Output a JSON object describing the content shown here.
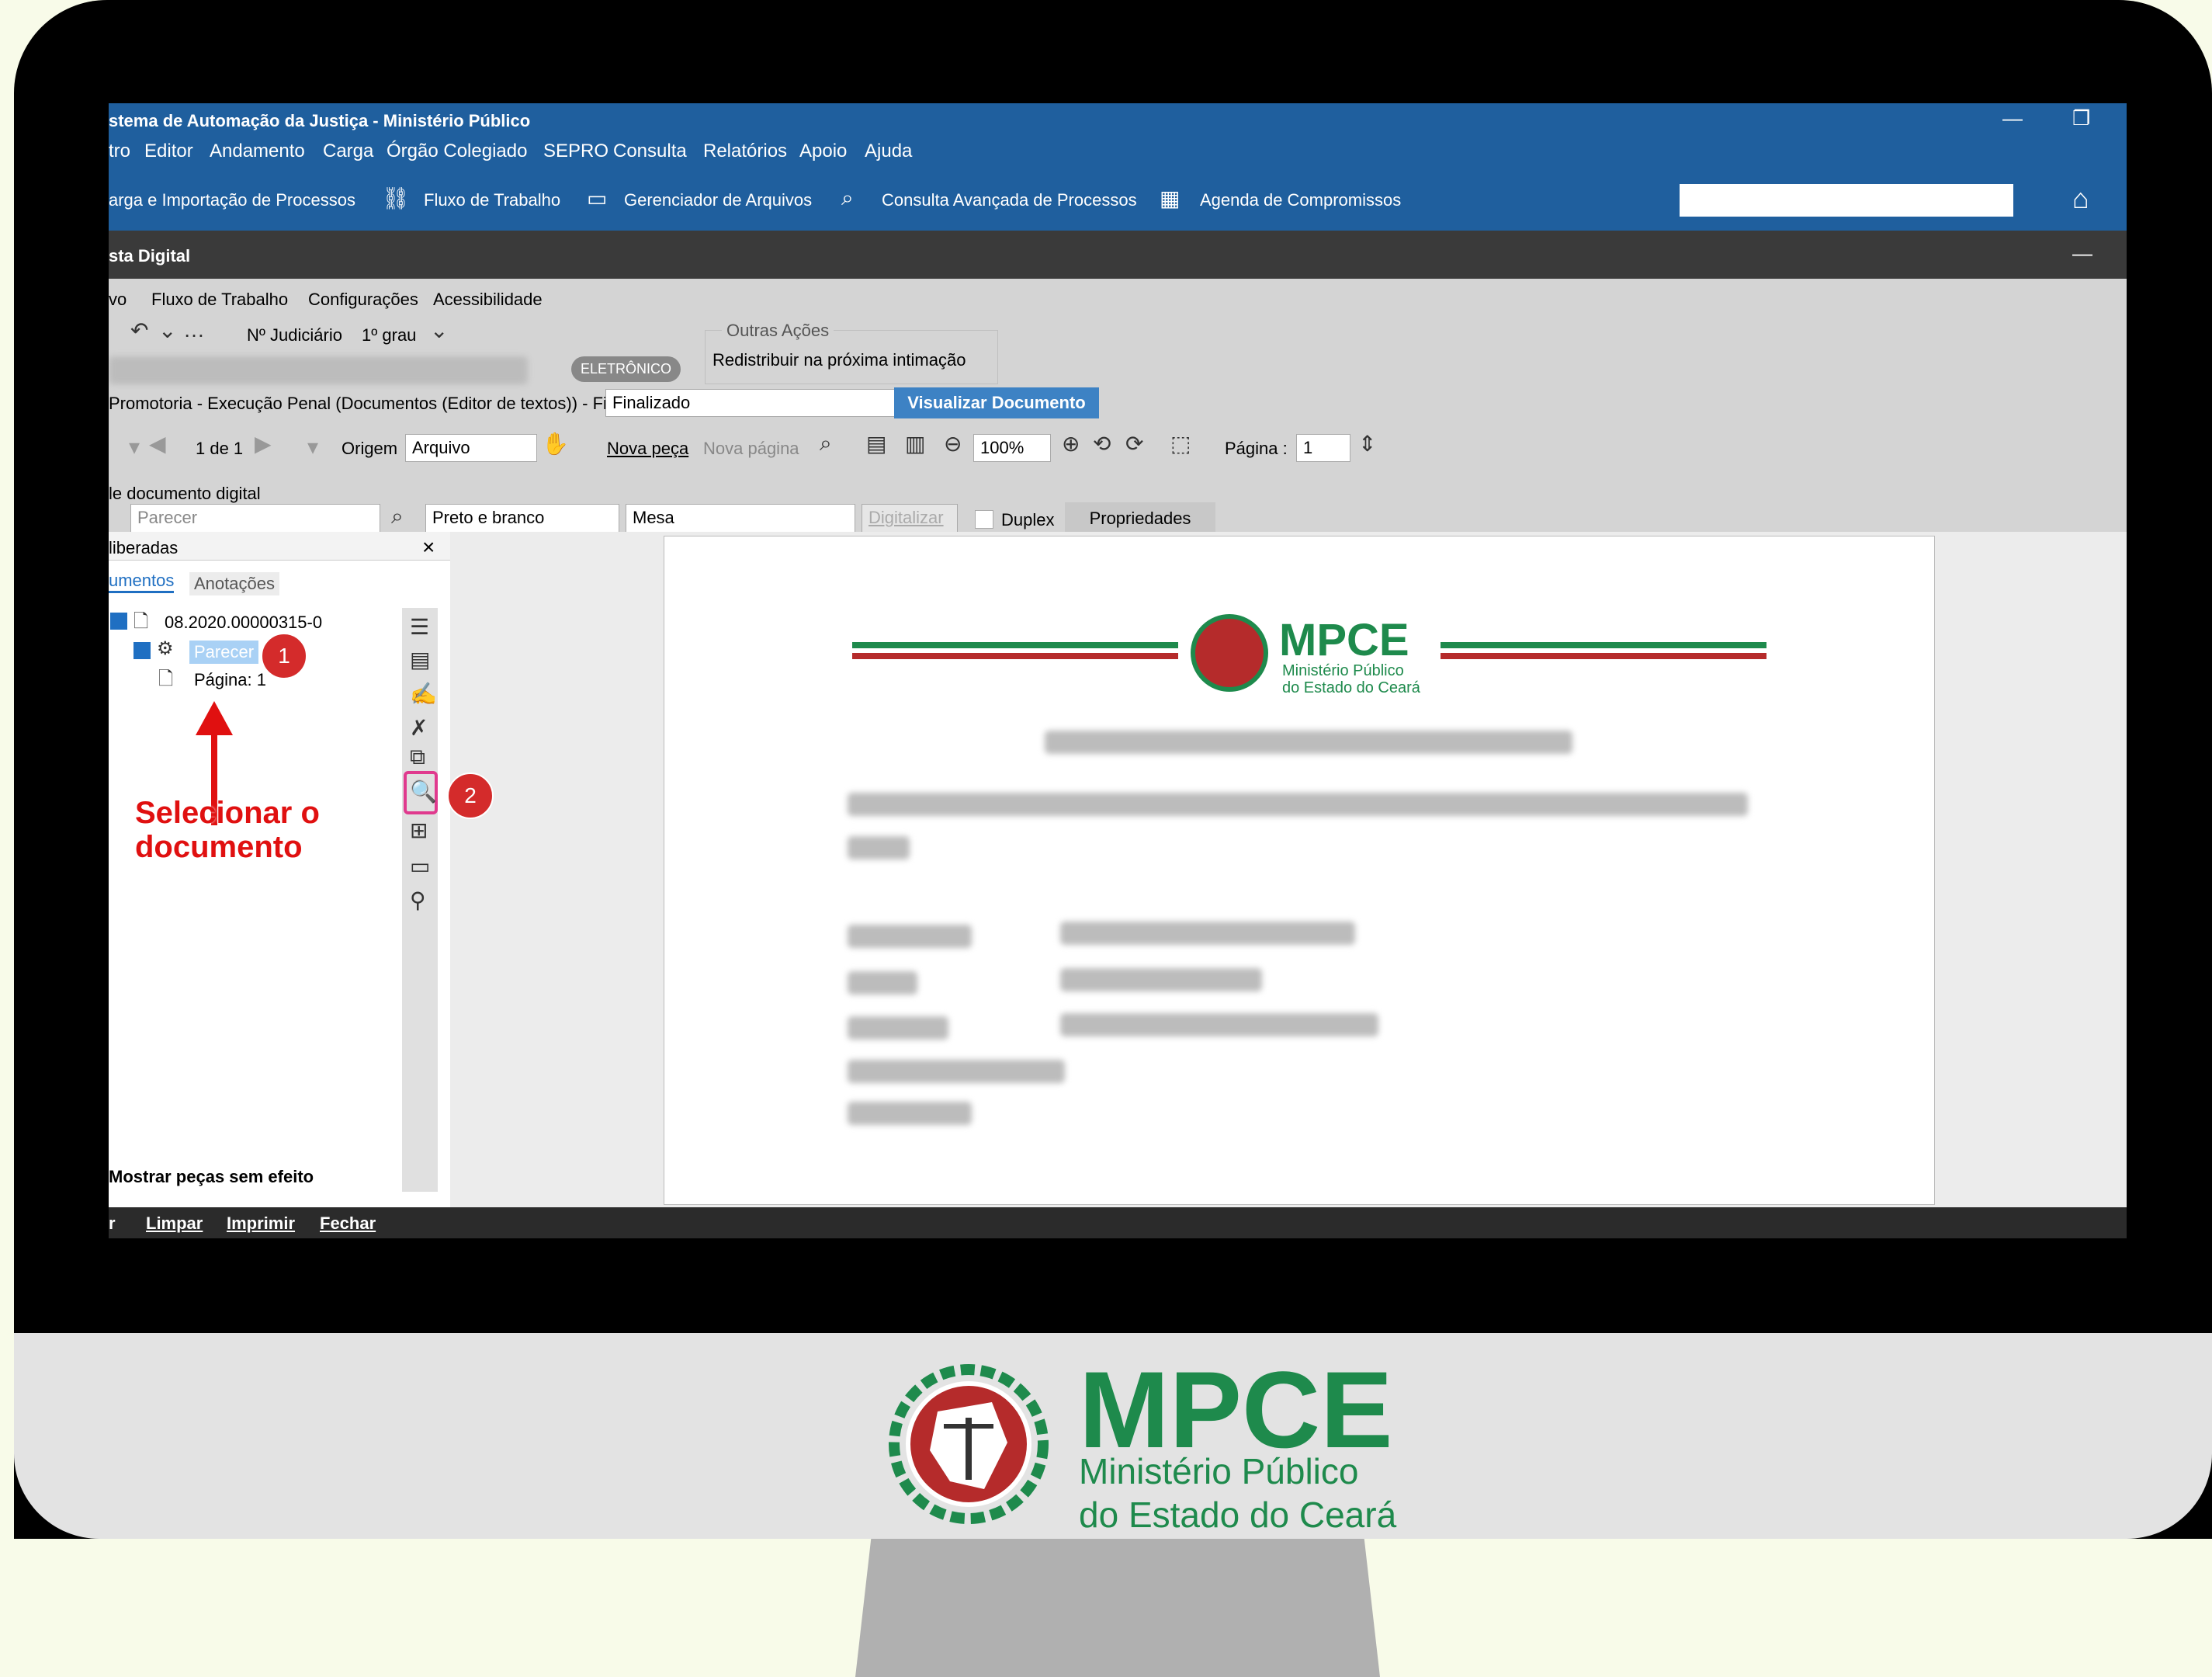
{
  "window": {
    "title": "stema de Automação da Justiça - Ministério Público",
    "minimize_glyph": "—",
    "restore_glyph": "❐"
  },
  "menu": [
    "tro",
    "Editor",
    "Andamento",
    "Carga",
    "Órgão Colegiado",
    "SEPRO",
    "Consulta",
    "Relatórios",
    "Apoio",
    "Ajuda"
  ],
  "toolbar": {
    "items": [
      {
        "label": "arga e Importação de Processos",
        "icon": ""
      },
      {
        "label": "Fluxo de Trabalho",
        "icon": "flow-icon"
      },
      {
        "label": "Gerenciador de Arquivos",
        "icon": "file-manager-icon"
      },
      {
        "label": "Consulta Avançada de Processos",
        "icon": "search-icon"
      },
      {
        "label": "Agenda de Compromissos",
        "icon": "calendar-icon"
      }
    ],
    "search_value": "",
    "home_icon": "home-icon"
  },
  "subwindow": {
    "title": "sta Digital",
    "minimize_glyph": "—",
    "menu": [
      "vo",
      "Fluxo de Trabalho",
      "Configurações",
      "Acessibilidade"
    ]
  },
  "header": {
    "judicial_label": "Nº Judiciário",
    "instance": "1º grau",
    "eletronico_badge": "ELETRÔNICO",
    "outras_acoes_title": "Outras Ações",
    "redistribuir": "Redistribuir na próxima intimação",
    "queue_label": "Promotoria - Execução Penal (Documentos (Editor de textos)) - Fila",
    "queue_value": "Finalizado",
    "visualizar_button": "Visualizar Documento"
  },
  "viewer_toolbar": {
    "page_of": "1 de 1",
    "origem_label": "Origem",
    "origem_value": "Arquivo",
    "nova_peca": "Nova peça",
    "nova_pagina": "Nova página",
    "zoom": "100%",
    "pagina_label": "Página :",
    "pagina_value": "1"
  },
  "scan": {
    "section_label": "le documento digital",
    "type_placeholder": "Parecer",
    "color_value": "Preto e branco",
    "source_value": "Mesa",
    "digitalizar": "Digitalizar",
    "duplex": "Duplex",
    "propriedades": "Propriedades"
  },
  "left_panel": {
    "title": "liberadas",
    "close": "×",
    "tabs": [
      "umentos",
      "Anotações"
    ],
    "tree": {
      "root": "08.2020.00000315-0",
      "child": "Parecer",
      "page": "Página: 1"
    },
    "show_effectless": "Mostrar peças sem efeito"
  },
  "annotations": {
    "badge1": "1",
    "badge2": "2",
    "arrow_text_line1": "Selecionar o",
    "arrow_text_line2": "documento"
  },
  "bottom_actions": [
    "r",
    "Limpar",
    "Imprimir",
    "Fechar"
  ],
  "document": {
    "logo_text": "MPCE",
    "logo_sub1": "Ministério Público",
    "logo_sub2": "do Estado do Ceará"
  },
  "brand": {
    "logo_text": "MPCE",
    "line1": "Ministério Público",
    "line2": "do Estado do Ceará",
    "green": "#1e8a4c",
    "red": "#b52b2b"
  }
}
